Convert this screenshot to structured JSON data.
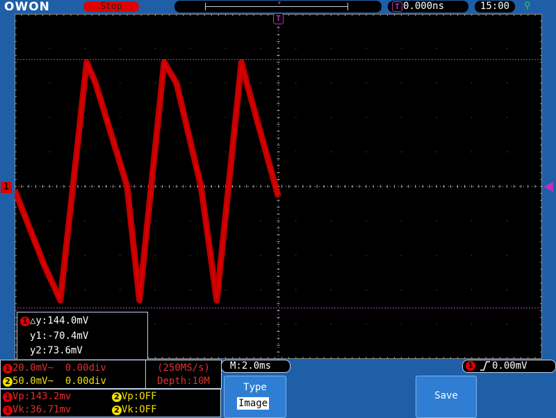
{
  "header": {
    "brand": "OWON",
    "run_status": "Stop",
    "trigger_position_badge": "T",
    "horizontal_position": "0.000ns",
    "clock": "15:00",
    "usb_icon": "usb-icon"
  },
  "markers": {
    "trigger_time_marker": "T",
    "ch1_level_marker": "1"
  },
  "cursor_measure": {
    "channel": "1",
    "delta_y": "△y:144.0mV",
    "y1": "y1:-70.4mV",
    "y2": "y2:73.6mV"
  },
  "channels": [
    {
      "badge": "1",
      "scale": "20.0mV~",
      "offset": "0.00div",
      "color": "#e10000"
    },
    {
      "badge": "2",
      "scale": "50.0mV~",
      "offset": "0.00div",
      "color": "#f0e000"
    }
  ],
  "acquisition": {
    "sample_rate": "(250MS/s)",
    "depth": "Depth:10M"
  },
  "timebase": "M:2.0ms",
  "trigger_readout": {
    "channel": "1",
    "edge": "rising-edge-icon",
    "level": "0.00mV"
  },
  "measurements": [
    {
      "badge": "1",
      "text": "Vp:143.2mv"
    },
    {
      "badge": "2",
      "text": "Vp:OFF"
    },
    {
      "badge": "1",
      "text": "Vk:36.71mv"
    },
    {
      "badge": "2",
      "text": "Vk:OFF"
    }
  ],
  "softkeys": {
    "type_label": "Type",
    "type_value": "Image",
    "save_label": "Save"
  },
  "colors": {
    "background_blue": "#1e5fa8",
    "ch1": "#e10000",
    "ch2": "#f0e000",
    "trigger_magenta": "#c030c0",
    "cursor_lines": "#b040d0"
  },
  "chart_data": {
    "type": "line",
    "series": [
      {
        "color": "#e10000",
        "x_div": [
          0,
          0.85,
          1.3,
          2.05,
          2.3,
          3.2,
          3.55,
          4.25,
          4.6,
          5.3,
          5.75,
          6.45,
          6.6,
          7.5
        ],
        "y_div": [
          -0.1,
          -2.3,
          -3.3,
          3.6,
          3.0,
          0.0,
          -3.3,
          3.6,
          3.0,
          0.0,
          -3.3,
          3.6,
          3.0,
          -0.3
        ]
      }
    ],
    "x_divisions": 15,
    "y_divisions": 10,
    "cursors_y_mv": [
      -70.4,
      73.6
    ],
    "grid": true
  }
}
